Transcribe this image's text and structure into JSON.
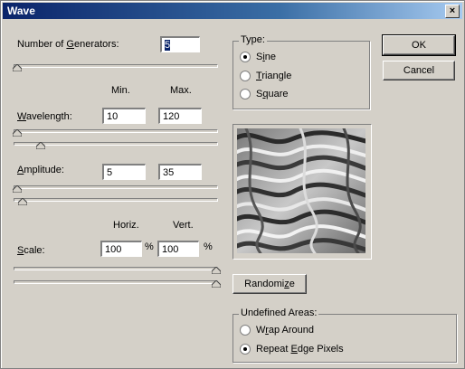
{
  "window": {
    "title": "Wave",
    "close_glyph": "×"
  },
  "generators": {
    "label_pre": "Number of ",
    "label_u": "G",
    "label_post": "enerators:",
    "value": "5"
  },
  "column_headers": {
    "min": "Min.",
    "max": "Max."
  },
  "wavelength": {
    "label_u": "W",
    "label_post": "avelength:",
    "min": "10",
    "max": "120"
  },
  "amplitude": {
    "label_u": "A",
    "label_post": "mplitude:",
    "min": "5",
    "max": "35"
  },
  "scale_headers": {
    "horiz": "Horiz.",
    "vert": "Vert."
  },
  "scale": {
    "label_u": "S",
    "label_post": "cale:",
    "horiz": "100",
    "vert": "100",
    "unit": "%"
  },
  "type_group": {
    "title": "Type:",
    "options": [
      {
        "pre": "S",
        "u": "i",
        "post": "ne",
        "selected": true
      },
      {
        "pre": "",
        "u": "T",
        "post": "riangle",
        "selected": false
      },
      {
        "pre": "S",
        "u": "q",
        "post": "uare",
        "selected": false
      }
    ]
  },
  "buttons": {
    "ok": "OK",
    "cancel": "Cancel",
    "randomize_pre": "Randomi",
    "randomize_u": "z",
    "randomize_post": "e"
  },
  "undefined_areas": {
    "title": "Undefined Areas:",
    "options": [
      {
        "pre": "W",
        "u": "r",
        "post": "ap Around",
        "selected": false
      },
      {
        "pre": "Repeat ",
        "u": "E",
        "post": "dge Pixels",
        "selected": true
      }
    ]
  }
}
